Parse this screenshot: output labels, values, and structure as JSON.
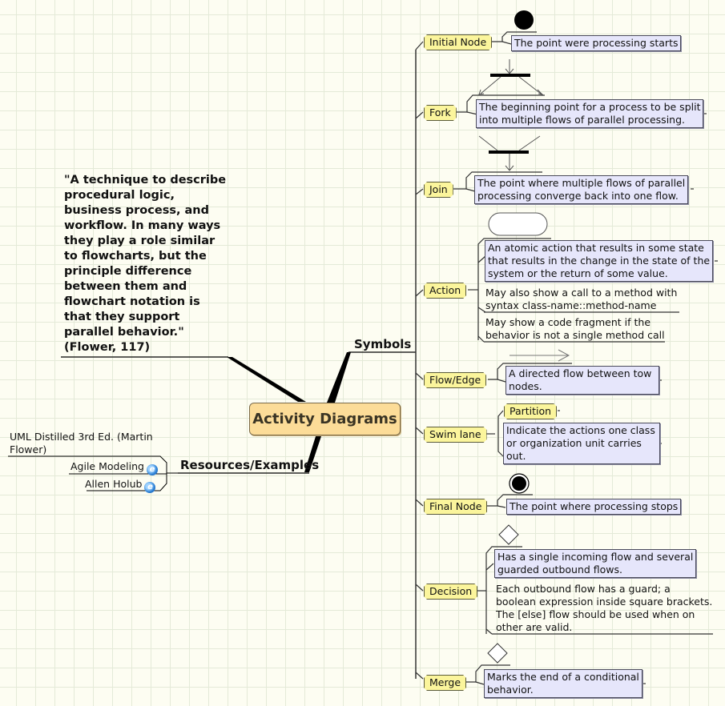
{
  "central_topic": "Activity Diagrams",
  "quote": {
    "lines": [
      "\"A technique to describe",
      "procedural logic,",
      "business process, and",
      "workflow.  In many ways",
      "they play a role similar",
      "to flowcharts, but the",
      "principle difference",
      "between them and",
      "flowchart notation is",
      "that they support",
      "parallel behavior.\"",
      "(Flower, 117)"
    ]
  },
  "branches": {
    "symbols": "Symbols",
    "resources": "Resources/Examples"
  },
  "resources": {
    "book": [
      "UML Distilled 3rd Ed.  (Martin",
      "Flower)"
    ],
    "links": [
      {
        "label": "Agile Modeling",
        "icon": "internet-explorer-link-icon"
      },
      {
        "label": "Allen Holub",
        "icon": "internet-explorer-link-icon"
      }
    ]
  },
  "symbols": [
    {
      "label": "Initial Node",
      "glyph": "filled-circle",
      "notes": [
        {
          "boxed": true,
          "lines": [
            "The point were processing starts"
          ]
        }
      ]
    },
    {
      "label": "Fork",
      "glyph": "fork-bar",
      "notes": [
        {
          "boxed": true,
          "lines": [
            "The beginning point for a process to be split",
            "into multiple flows of parallel processing."
          ]
        }
      ]
    },
    {
      "label": "Join",
      "glyph": "join-bar",
      "notes": [
        {
          "boxed": true,
          "lines": [
            "The point where multiple flows of parallel",
            "processing converge back into one flow."
          ]
        }
      ]
    },
    {
      "label": "Action",
      "glyph": "rounded-rectangle",
      "notes": [
        {
          "boxed": true,
          "lines": [
            "An atomic action that results in some state",
            "that results in the change in the state of the",
            "system or the return of some value."
          ]
        },
        {
          "boxed": false,
          "lines": [
            "May also show a call to a method with",
            "syntax class-name::method-name"
          ]
        },
        {
          "boxed": false,
          "lines": [
            "May show a code fragment if the",
            "behavior is not a single method call"
          ]
        }
      ]
    },
    {
      "label": "Flow/Edge",
      "glyph": "arrow",
      "notes": [
        {
          "boxed": true,
          "lines": [
            "A directed flow between tow",
            "nodes."
          ]
        }
      ]
    },
    {
      "label": "Swim lane",
      "sub_label": "Partition",
      "notes": [
        {
          "boxed": true,
          "lines": [
            "Indicate the actions one class",
            "or organization unit carries",
            "out."
          ]
        }
      ]
    },
    {
      "label": "Final Node",
      "glyph": "bullseye",
      "notes": [
        {
          "boxed": true,
          "lines": [
            "The point where processing stops"
          ]
        }
      ]
    },
    {
      "label": "Decision",
      "glyph": "diamond",
      "notes": [
        {
          "boxed": true,
          "lines": [
            "Has a single incoming flow and several",
            "guarded outbound flows."
          ]
        },
        {
          "boxed": false,
          "lines": [
            "Each outbound flow has a guard; a",
            "boolean expression inside square brackets.",
            "The [else] flow should be used when on",
            "other are valid."
          ]
        }
      ]
    },
    {
      "label": "Merge",
      "glyph": "diamond",
      "notes": [
        {
          "boxed": true,
          "lines": [
            "Marks the end of a conditional",
            "behavior."
          ]
        }
      ]
    }
  ],
  "colors": {
    "background": "#fdfdf2",
    "grid": "#e4ead8",
    "central_fill": "#fcdc98",
    "symbol_fill": "#fbf59c",
    "note_fill": "#e6e6fb"
  }
}
